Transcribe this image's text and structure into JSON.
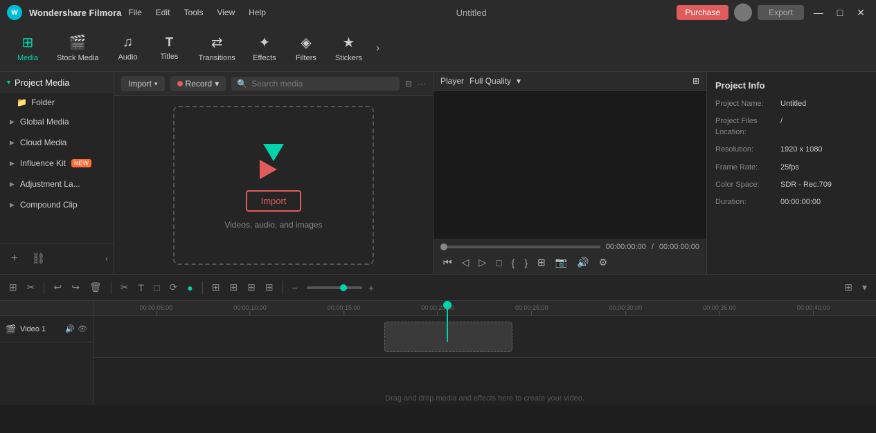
{
  "app": {
    "name": "Wondershare Filmora",
    "logo_text": "W",
    "title": "Untitled"
  },
  "menu": {
    "items": [
      "File",
      "Edit",
      "Tools",
      "View",
      "Help"
    ]
  },
  "title_bar": {
    "purchase_label": "Purchase",
    "export_label": "Export",
    "minimize": "—",
    "maximize": "□",
    "close": "✕"
  },
  "toolbar": {
    "items": [
      {
        "id": "media",
        "icon": "⊞",
        "label": "Media",
        "active": true
      },
      {
        "id": "stock-media",
        "icon": "🎬",
        "label": "Stock Media",
        "active": false
      },
      {
        "id": "audio",
        "icon": "♫",
        "label": "Audio",
        "active": false
      },
      {
        "id": "titles",
        "icon": "T",
        "label": "Titles",
        "active": false
      },
      {
        "id": "transitions",
        "icon": "⇄",
        "label": "Transitions",
        "active": false
      },
      {
        "id": "effects",
        "icon": "✦",
        "label": "Effects",
        "active": false
      },
      {
        "id": "filters",
        "icon": "◈",
        "label": "Filters",
        "active": false
      },
      {
        "id": "stickers",
        "icon": "★",
        "label": "Stickers",
        "active": false
      }
    ],
    "expand_icon": "›"
  },
  "left_panel": {
    "title": "Project Media",
    "folder_label": "Folder",
    "items": [
      {
        "label": "Global Media"
      },
      {
        "label": "Cloud Media"
      },
      {
        "label": "Influence Kit",
        "badge": "NEW"
      },
      {
        "label": "Adjustment La..."
      },
      {
        "label": "Compound Clip"
      }
    ],
    "add_icon": "+",
    "folder_icon": "📁",
    "collapse_icon": "‹"
  },
  "media_toolbar": {
    "import_label": "Import",
    "record_label": "Record",
    "search_placeholder": "Search media",
    "filter_icon": "⊟",
    "more_icon": "···"
  },
  "drop_area": {
    "import_button_label": "Import",
    "hint_text": "Videos, audio, and images"
  },
  "player": {
    "label": "Player",
    "quality": "Full Quality",
    "current_time": "00:00:00:00",
    "total_time": "00:00:00:00",
    "controls": [
      "⏮",
      "◁",
      "▷",
      "□",
      "{",
      "}",
      "⊞",
      "⊞",
      "⊞",
      "⊞",
      "⊞",
      "⊞"
    ]
  },
  "project_info": {
    "title": "Project Info",
    "fields": [
      {
        "label": "Project Name:",
        "value": "Untitled"
      },
      {
        "label": "Project Files Location:",
        "value": "/"
      },
      {
        "label": "Resolution:",
        "value": "1920 x 1080"
      },
      {
        "label": "Frame Rate:",
        "value": "25fps"
      },
      {
        "label": "Color Space:",
        "value": "SDR - Rec.709"
      },
      {
        "label": "Duration:",
        "value": "00:00:00:00"
      }
    ]
  },
  "timeline": {
    "toolbar_buttons": [
      "⊞",
      "✂",
      "↩",
      "↪",
      "🗑",
      "✂",
      "T",
      "□",
      "⟳",
      "●",
      "⊞",
      "⊞",
      "⊞",
      "⊞",
      "⊞",
      "⊞",
      "⊞",
      "⊞"
    ],
    "ruler_marks": [
      "00:00:05:00",
      "00:00:10:00",
      "00:00:15:00",
      "00:00:20:00",
      "00:00:25:00",
      "00:00:30:00",
      "00:00:35:00",
      "00:00:40:00"
    ],
    "track_name": "Video 1",
    "drop_hint": "Drag and drop media and effects here to create your video."
  },
  "timeline_bottom": {
    "track_num": "1",
    "icons": [
      "🎬",
      "🔊",
      "👁"
    ]
  }
}
